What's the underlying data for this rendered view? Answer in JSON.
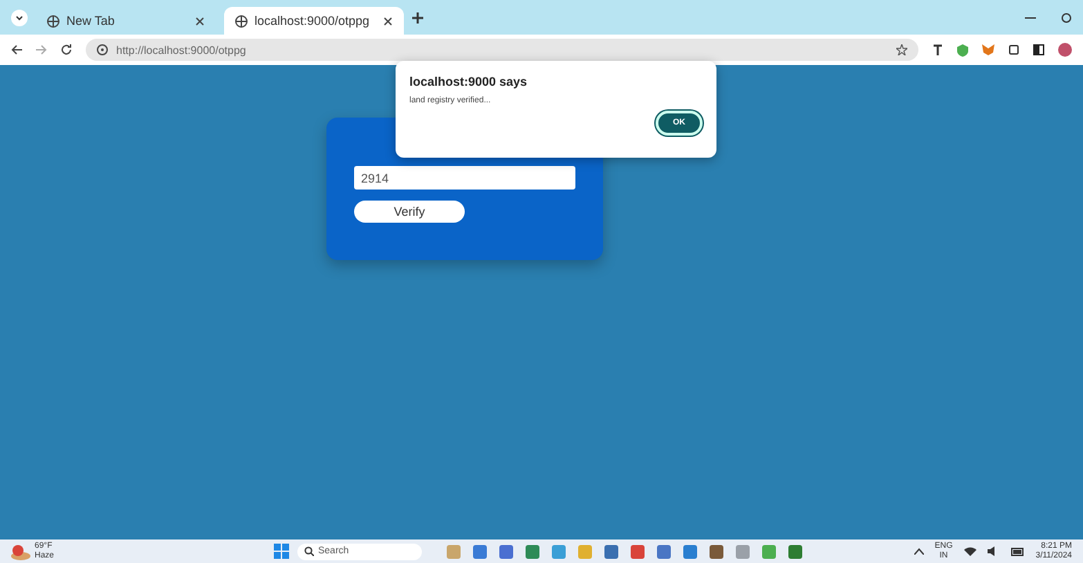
{
  "browser": {
    "tabs": [
      {
        "title": "New Tab",
        "selected": false
      },
      {
        "title": "localhost:9000/otppg",
        "selected": true
      }
    ],
    "address": "http://localhost:9000/otppg"
  },
  "page": {
    "otp_value": "2914",
    "verify_button": "Verify"
  },
  "dialog": {
    "title": "localhost:9000 says",
    "message": "land registry verified...",
    "ok_button": "OK"
  },
  "taskbar": {
    "weather_temp": "69°F",
    "weather_desc": "Haze",
    "search_placeholder": "Search",
    "language": "ENG",
    "region": "IN",
    "time": "8:21 PM",
    "date": "3/11/2024",
    "apps": [
      {
        "color": "#c9a66b"
      },
      {
        "color": "#3a7bd5"
      },
      {
        "color": "#4a6fd1"
      },
      {
        "color": "#2e8b57"
      },
      {
        "color": "#3a9fd6"
      },
      {
        "color": "#e0b030"
      },
      {
        "color": "#3a6fb0"
      },
      {
        "color": "#d9443a"
      },
      {
        "color": "#4a76c4"
      },
      {
        "color": "#2a7fd0"
      },
      {
        "color": "#7a5a3a"
      },
      {
        "color": "#9aa0a8"
      },
      {
        "color": "#4caf50"
      },
      {
        "color": "#2e7d32"
      }
    ]
  }
}
